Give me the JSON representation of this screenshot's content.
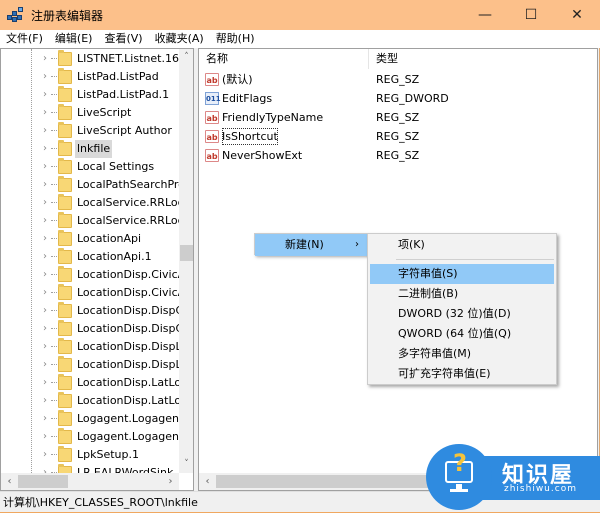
{
  "window": {
    "title": "注册表编辑器",
    "controls": {
      "minimize": "—",
      "maximize": "☐",
      "close": "✕"
    }
  },
  "menubar": [
    {
      "label": "文件(F)"
    },
    {
      "label": "编辑(E)"
    },
    {
      "label": "查看(V)"
    },
    {
      "label": "收藏夹(A)"
    },
    {
      "label": "帮助(H)"
    }
  ],
  "tree": {
    "items": [
      {
        "label": "LISTNET.Listnet.16",
        "selected": false
      },
      {
        "label": "ListPad.ListPad",
        "selected": false
      },
      {
        "label": "ListPad.ListPad.1",
        "selected": false
      },
      {
        "label": "LiveScript",
        "selected": false
      },
      {
        "label": "LiveScript Author",
        "selected": false
      },
      {
        "label": "lnkfile",
        "selected": true
      },
      {
        "label": "Local Settings",
        "selected": false
      },
      {
        "label": "LocalPathSearchPro",
        "selected": false
      },
      {
        "label": "LocalService.RRLoca",
        "selected": false
      },
      {
        "label": "LocalService.RRLoca",
        "selected": false
      },
      {
        "label": "LocationApi",
        "selected": false
      },
      {
        "label": "LocationApi.1",
        "selected": false
      },
      {
        "label": "LocationDisp.CivicAd",
        "selected": false
      },
      {
        "label": "LocationDisp.CivicAd",
        "selected": false
      },
      {
        "label": "LocationDisp.DispCi",
        "selected": false
      },
      {
        "label": "LocationDisp.DispCi",
        "selected": false
      },
      {
        "label": "LocationDisp.DispLa",
        "selected": false
      },
      {
        "label": "LocationDisp.DispLa",
        "selected": false
      },
      {
        "label": "LocationDisp.LatLon",
        "selected": false
      },
      {
        "label": "LocationDisp.LatLon",
        "selected": false
      },
      {
        "label": "Logagent.Logagent",
        "selected": false
      },
      {
        "label": "Logagent.Logagent",
        "selected": false
      },
      {
        "label": "LpkSetup.1",
        "selected": false
      },
      {
        "label": "LR.EALRWordSink",
        "selected": false
      }
    ],
    "chevron": "›",
    "scroll_up": "˄",
    "scroll_down": "˅",
    "scroll_left": "‹",
    "scroll_right": "›"
  },
  "values": {
    "columns": {
      "name": "名称",
      "type": "类型"
    },
    "rows": [
      {
        "icon": "string-value-icon",
        "glyph": "ab",
        "name": "(默认)",
        "type": "REG_SZ"
      },
      {
        "icon": "dword-value-icon",
        "glyph": "011",
        "name": "EditFlags",
        "type": "REG_DWORD"
      },
      {
        "icon": "string-value-icon",
        "glyph": "ab",
        "name": "FriendlyTypeName",
        "type": "REG_SZ"
      },
      {
        "icon": "string-value-icon",
        "glyph": "ab",
        "name": "IsShortcut",
        "type": "REG_SZ",
        "focused": true
      },
      {
        "icon": "string-value-icon",
        "glyph": "ab",
        "name": "NeverShowExt",
        "type": "REG_SZ"
      }
    ],
    "scroll_left": "‹"
  },
  "context_menu": {
    "new_label": "新建(N)",
    "arrow": "›",
    "submenu": {
      "key": "项(K)",
      "items": [
        {
          "label": "字符串值(S)",
          "highlighted": true
        },
        {
          "label": "二进制值(B)",
          "highlighted": false
        },
        {
          "label": "DWORD (32 位)值(D)",
          "highlighted": false
        },
        {
          "label": "QWORD (64 位)值(Q)",
          "highlighted": false
        },
        {
          "label": "多字符串值(M)",
          "highlighted": false
        },
        {
          "label": "可扩充字符串值(E)",
          "highlighted": false
        }
      ]
    }
  },
  "statusbar": {
    "path": "计算机\\HKEY_CLASSES_ROOT\\lnkfile"
  },
  "watermark": {
    "title": "知识屋",
    "url": "zhishiwu.com",
    "glyph": "?"
  },
  "colors": {
    "titlebar": "#fcc08a",
    "highlight": "#91c9f7",
    "watermark_blue": "#2f8be0"
  }
}
